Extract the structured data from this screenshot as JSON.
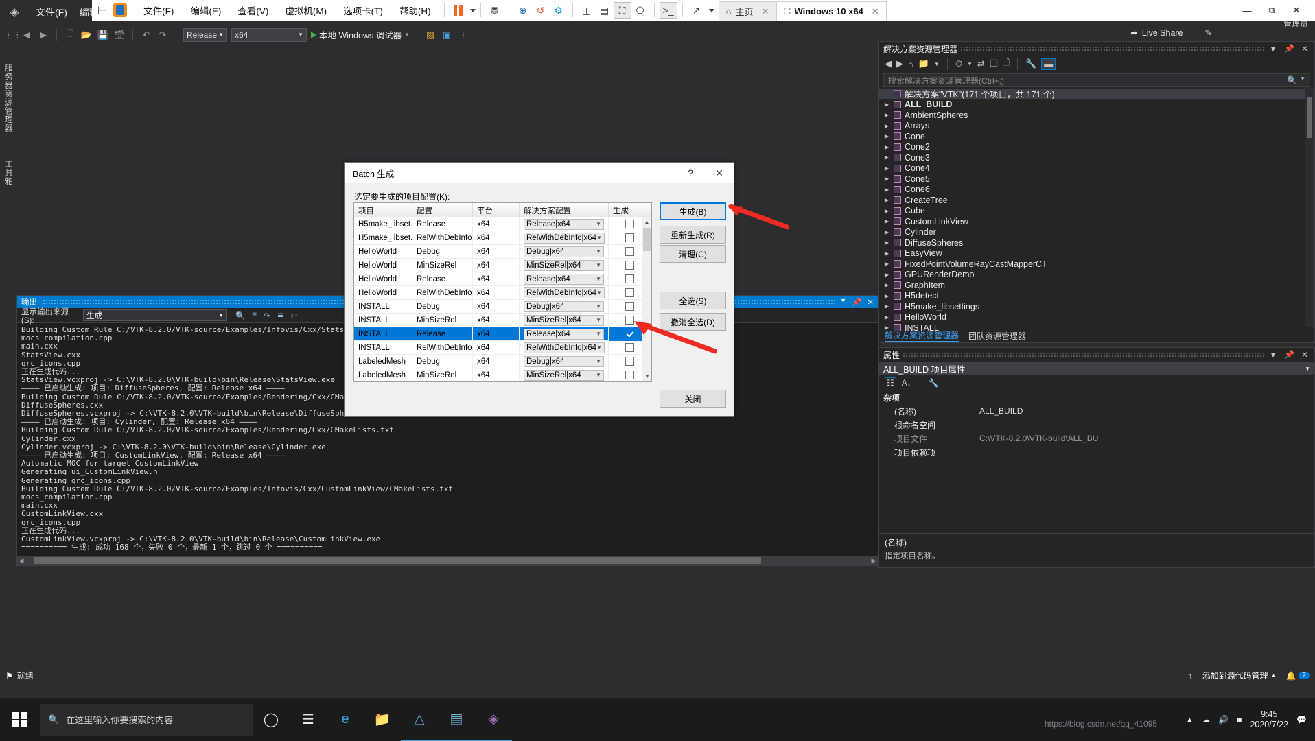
{
  "vs": {
    "menus": [
      "文件(F)",
      "编辑(E)"
    ],
    "toolbar": {
      "config": "Release",
      "platform": "x64",
      "run_label": "本地 Windows 调试器",
      "live_share": "Live Share",
      "account": "管理员"
    },
    "left_tabs": [
      "服务器资源管理器",
      "工具箱"
    ],
    "status": {
      "ready": "就绪",
      "source_control": "添加到源代码管理",
      "notify": "2"
    }
  },
  "vmware": {
    "menus": [
      "文件(F)",
      "编辑(E)",
      "查看(V)",
      "虚拟机(M)",
      "选项卡(T)",
      "帮助(H)"
    ],
    "tabs": [
      {
        "label": "主页",
        "icon": "home-icon",
        "active": false
      },
      {
        "label": "Windows 10 x64",
        "icon": "vm-play-icon",
        "active": true
      }
    ],
    "window_buttons": [
      "最小化",
      "还原",
      "关闭"
    ]
  },
  "output": {
    "title": "输出",
    "source_label": "显示输出来源(S):",
    "source_value": "生成",
    "lines": [
      "Building Custom Rule C:/VTK-8.2.0/VTK-source/Examples/Infovis/Cxx/StatsView/CMakeLists.txt",
      "mocs_compilation.cpp",
      "main.cxx",
      "StatsView.cxx",
      "qrc_icons.cpp",
      "正在生成代码...",
      "StatsView.vcxproj -> C:\\VTK-8.2.0\\VTK-build\\bin\\Release\\StatsView.exe",
      "———— 已启动生成: 项目: DiffuseSpheres, 配置: Release x64 ————",
      "Building Custom Rule C:/VTK-8.2.0/VTK-source/Examples/Rendering/Cxx/CMakeLists.txt",
      "DiffuseSpheres.cxx",
      "DiffuseSpheres.vcxproj -> C:\\VTK-8.2.0\\VTK-build\\bin\\Release\\DiffuseSpheres.exe",
      "———— 已启动生成: 项目: Cylinder, 配置: Release x64 ————",
      "Building Custom Rule C:/VTK-8.2.0/VTK-source/Examples/Rendering/Cxx/CMakeLists.txt",
      "Cylinder.cxx",
      "Cylinder.vcxproj -> C:\\VTK-8.2.0\\VTK-build\\bin\\Release\\Cylinder.exe",
      "———— 已启动生成: 项目: CustomLinkView, 配置: Release x64 ————",
      "Automatic MOC for target CustomLinkView",
      "Generating ui_CustomLinkView.h",
      "Generating qrc_icons.cpp",
      "Building Custom Rule C:/VTK-8.2.0/VTK-source/Examples/Infovis/Cxx/CustomLinkView/CMakeLists.txt",
      "mocs_compilation.cpp",
      "main.cxx",
      "CustomLinkView.cxx",
      "qrc_icons.cpp",
      "正在生成代码...",
      "CustomLinkView.vcxproj -> C:\\VTK-8.2.0\\VTK-build\\bin\\Release\\CustomLinkView.exe",
      "========== 生成: 成功 168 个，失败 0 个，最新 1 个，跳过 0 个 =========="
    ]
  },
  "solution_explorer": {
    "title": "解决方案资源管理器",
    "search_placeholder": "搜索解决方案资源管理器(Ctrl+;)",
    "root": "解决方案\"VTK\"(171 个项目，共 171 个)",
    "items": [
      "ALL_BUILD",
      "AmbientSpheres",
      "Arrays",
      "Cone",
      "Cone2",
      "Cone3",
      "Cone4",
      "Cone5",
      "Cone6",
      "CreateTree",
      "Cube",
      "CustomLinkView",
      "Cylinder",
      "DiffuseSpheres",
      "EasyView",
      "FixedPointVolumeRayCastMapperCT",
      "GPURenderDemo",
      "GraphItem",
      "H5detect",
      "H5make_libsettings",
      "HelloWorld",
      "INSTALL"
    ],
    "tabs": [
      {
        "label": "解决方案资源管理器",
        "active": true
      },
      {
        "label": "团队资源管理器",
        "active": false
      }
    ]
  },
  "properties": {
    "title": "属性",
    "header": "ALL_BUILD 项目属性",
    "group": "杂项",
    "rows": [
      {
        "key": "(名称)",
        "value": "ALL_BUILD",
        "dim": false
      },
      {
        "key": "根命名空间",
        "value": "",
        "dim": false
      },
      {
        "key": "项目文件",
        "value": "C:\\VTK-8.2.0\\VTK-build\\ALL_BU",
        "dim": true
      },
      {
        "key": "项目依赖项",
        "value": "",
        "dim": false
      }
    ],
    "footer_title": "(名称)",
    "footer_desc": "指定项目名称。"
  },
  "dialog": {
    "title": "Batch 生成",
    "help_glyph": "?",
    "close_glyph": "✕",
    "label": "选定要生成的项目配置(K):",
    "columns": [
      "项目",
      "配置",
      "平台",
      "解决方案配置",
      "生成"
    ],
    "rows": [
      {
        "project": "H5make_libset...",
        "config": "Release",
        "platform": "x64",
        "solution": "Release|x64",
        "build": false,
        "selected": false
      },
      {
        "project": "H5make_libset...",
        "config": "RelWithDebInfo",
        "platform": "x64",
        "solution": "RelWithDebInfo|x64",
        "build": false,
        "selected": false
      },
      {
        "project": "HelloWorld",
        "config": "Debug",
        "platform": "x64",
        "solution": "Debug|x64",
        "build": false,
        "selected": false
      },
      {
        "project": "HelloWorld",
        "config": "MinSizeRel",
        "platform": "x64",
        "solution": "MinSizeRel|x64",
        "build": false,
        "selected": false
      },
      {
        "project": "HelloWorld",
        "config": "Release",
        "platform": "x64",
        "solution": "Release|x64",
        "build": false,
        "selected": false
      },
      {
        "project": "HelloWorld",
        "config": "RelWithDebInfo",
        "platform": "x64",
        "solution": "RelWithDebInfo|x64",
        "build": false,
        "selected": false
      },
      {
        "project": "INSTALL",
        "config": "Debug",
        "platform": "x64",
        "solution": "Debug|x64",
        "build": false,
        "selected": false
      },
      {
        "project": "INSTALL",
        "config": "MinSizeRel",
        "platform": "x64",
        "solution": "MinSizeRel|x64",
        "build": false,
        "selected": false
      },
      {
        "project": "INSTALL",
        "config": "Release",
        "platform": "x64",
        "solution": "Release|x64",
        "build": true,
        "selected": true
      },
      {
        "project": "INSTALL",
        "config": "RelWithDebInfo",
        "platform": "x64",
        "solution": "RelWithDebInfo|x64",
        "build": false,
        "selected": false
      },
      {
        "project": "LabeledMesh",
        "config": "Debug",
        "platform": "x64",
        "solution": "Debug|x64",
        "build": false,
        "selected": false
      },
      {
        "project": "LabeledMesh",
        "config": "MinSizeRel",
        "platform": "x64",
        "solution": "MinSizeRel|x64",
        "build": false,
        "selected": false
      }
    ],
    "buttons": {
      "build": "生成(B)",
      "rebuild": "重新生成(R)",
      "clean": "清理(C)",
      "select_all": "全选(S)",
      "deselect_all": "撤消全选(D)",
      "close": "关闭"
    }
  },
  "taskbar": {
    "search_placeholder": "在这里输入你要搜索的内容",
    "clock_time": "9:45",
    "clock_date": "2020/7/22",
    "watermark": "https://blog.csdn.net/qq_41095"
  },
  "colors": {
    "accent": "#0078d7",
    "vs_chrome": "#2d2d30",
    "output_title": "#007acc",
    "arrow_red": "#ee2b20"
  }
}
